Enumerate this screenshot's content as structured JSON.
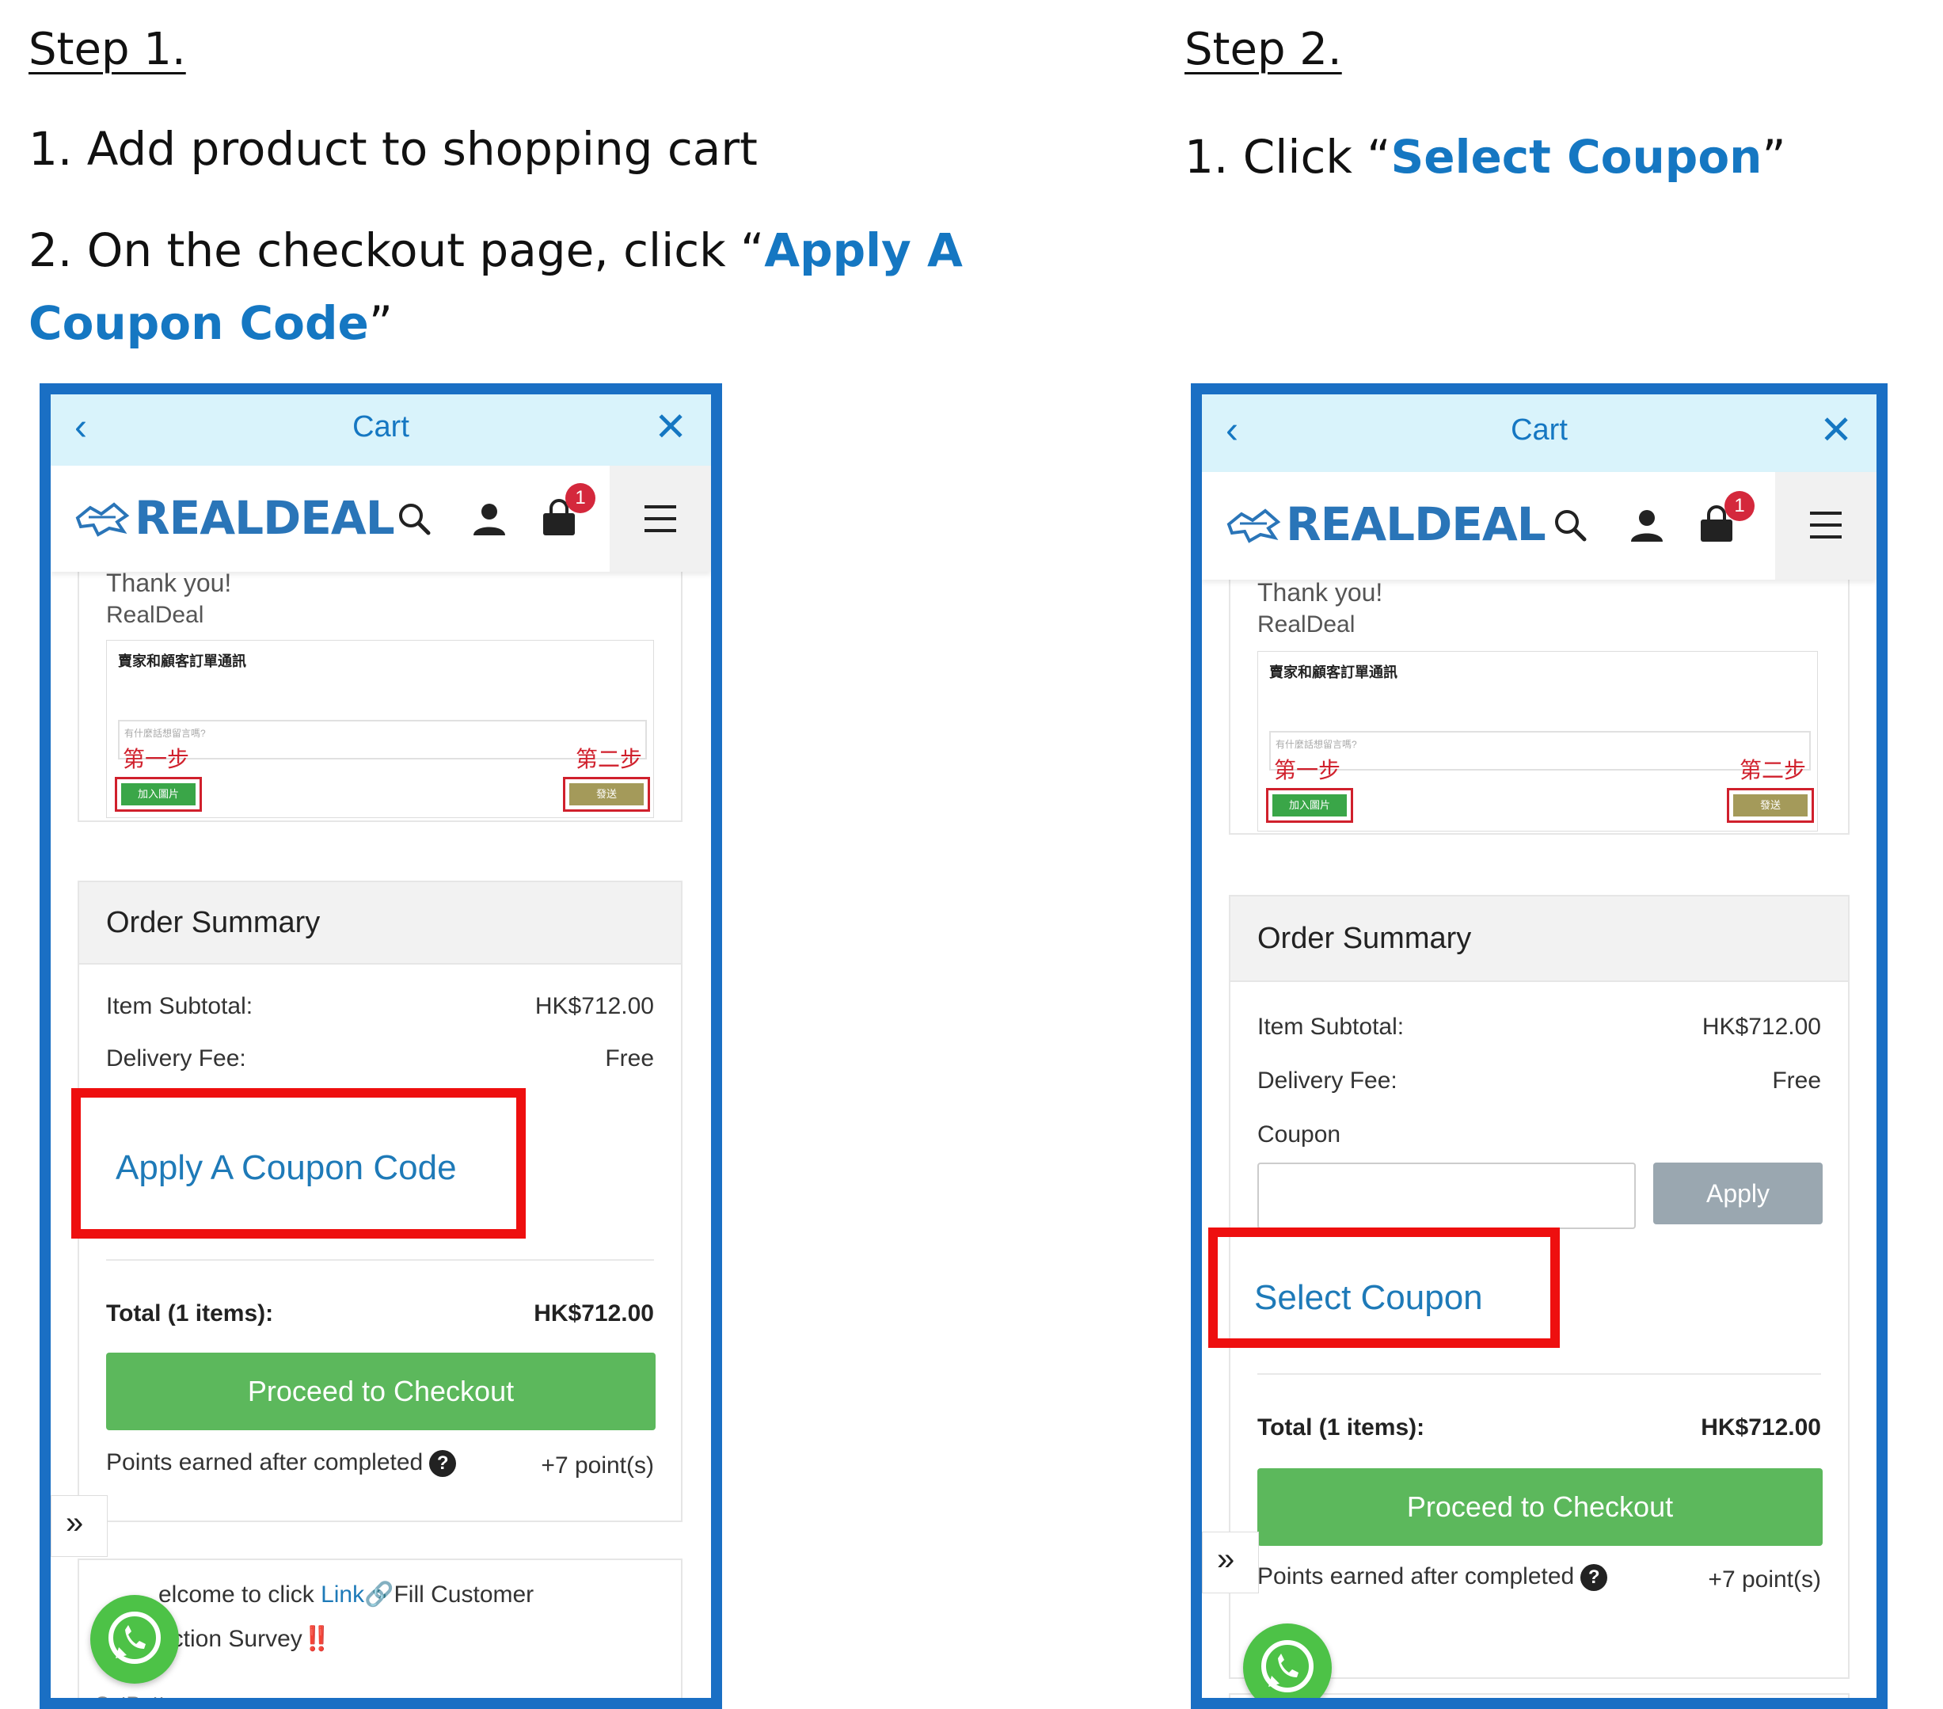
{
  "steps": [
    {
      "title": "Step 1.",
      "line1": "1. Add product to shopping cart",
      "line2_prefix": "2. On the checkout page, click “",
      "line2_highlight_a": "Apply A",
      "line2_highlight_b": "Coupon Code",
      "line2_suffix": "”"
    },
    {
      "title": "Step 2.",
      "line1_prefix": "1. Click “",
      "line1_highlight": "Select Coupon",
      "line1_suffix": "”"
    }
  ],
  "app": {
    "cart_title": "Cart",
    "brand": "REALDEAL",
    "cart_badge": "1",
    "thanks_text": "Thank you!",
    "signature": "RealDeal",
    "chat_heading": "賣家和顧客訂單通訊",
    "chat_placeholder": "有什麼話想留言嗎?",
    "step_one_cn": "第一步",
    "step_two_cn": "第二步",
    "add_image_btn": "加入圖片",
    "send_btn": "發送"
  },
  "left_screen": {
    "summary_title": "Order Summary",
    "subtotal_label": "Item Subtotal:",
    "subtotal_value": "HK$712.00",
    "delivery_label": "Delivery Fee:",
    "delivery_value": "Free",
    "coupon_link": "Apply A Coupon Code",
    "total_label": "Total (1 items):",
    "total_value": "HK$712.00",
    "checkout_label": "Proceed to Checkout",
    "points_label": "Points earned after completed",
    "points_value": "+7 point(s)",
    "survey_line1_a": "elcome to click ",
    "survey_link": "Link",
    "survey_line1_b": "🔗Fill Customer",
    "survey_line2": "action Survey",
    "survey_bang": "‼️",
    "getbutton": "GetButton"
  },
  "right_screen": {
    "summary_title": "Order Summary",
    "subtotal_label": "Item Subtotal:",
    "subtotal_value": "HK$712.00",
    "delivery_label": "Delivery Fee:",
    "delivery_value": "Free",
    "coupon_label": "Coupon",
    "coupon_input_value": "",
    "apply_label": "Apply",
    "select_coupon": "Select Coupon",
    "total_label": "Total (1 items):",
    "total_value": "HK$712.00",
    "checkout_label": "Proceed to Checkout",
    "points_label": "Points earned after completed",
    "points_value": "+7 point(s)"
  },
  "icons": [
    "chevron-left-icon",
    "close-icon",
    "search-icon",
    "user-icon",
    "shopping-bag-icon",
    "hamburger-menu-icon",
    "double-chevron-right-icon",
    "whatsapp-icon",
    "help-icon"
  ],
  "colors": {
    "frame_blue": "#1a6fc4",
    "highlight_blue": "#1577c2",
    "annotation_red": "#ee0f0f",
    "checkout_green": "#5cb85c",
    "cart_bar": "#d9f3fb"
  }
}
